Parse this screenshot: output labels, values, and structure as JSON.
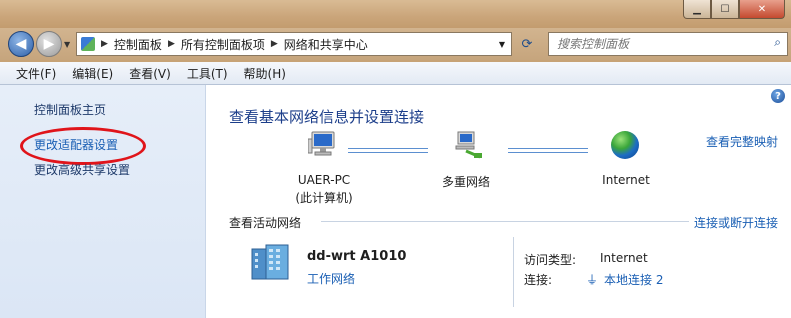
{
  "window": {
    "minimize_icon": "minimize-icon",
    "maximize_icon": "maximize-icon",
    "close_icon": "close-icon"
  },
  "nav": {
    "breadcrumb": [
      "控制面板",
      "所有控制面板项",
      "网络和共享中心"
    ],
    "search_placeholder": "搜索控制面板"
  },
  "menu": [
    "文件(F)",
    "编辑(E)",
    "查看(V)",
    "工具(T)",
    "帮助(H)"
  ],
  "sidebar": {
    "items": [
      {
        "label": "控制面板主页"
      },
      {
        "label": "更改适配器设置"
      },
      {
        "label": "更改高级共享设置"
      }
    ]
  },
  "main": {
    "title": "查看基本网络信息并设置连接",
    "view_full_map": "查看完整映射",
    "map": {
      "pc_name": "UAER-PC",
      "pc_sub": "(此计算机)",
      "middle": "多重网络",
      "internet": "Internet"
    },
    "active_title": "查看活动网络",
    "connect_link": "连接或断开连接",
    "network": {
      "name": "dd-wrt  A1010",
      "type": "工作网络",
      "access_label": "访问类型:",
      "access_value": "Internet",
      "conn_label": "连接:",
      "conn_value": "本地连接 2"
    }
  },
  "colors": {
    "link": "#1a5fb4",
    "title": "#1c3e8a",
    "annotation": "#e0141a"
  }
}
